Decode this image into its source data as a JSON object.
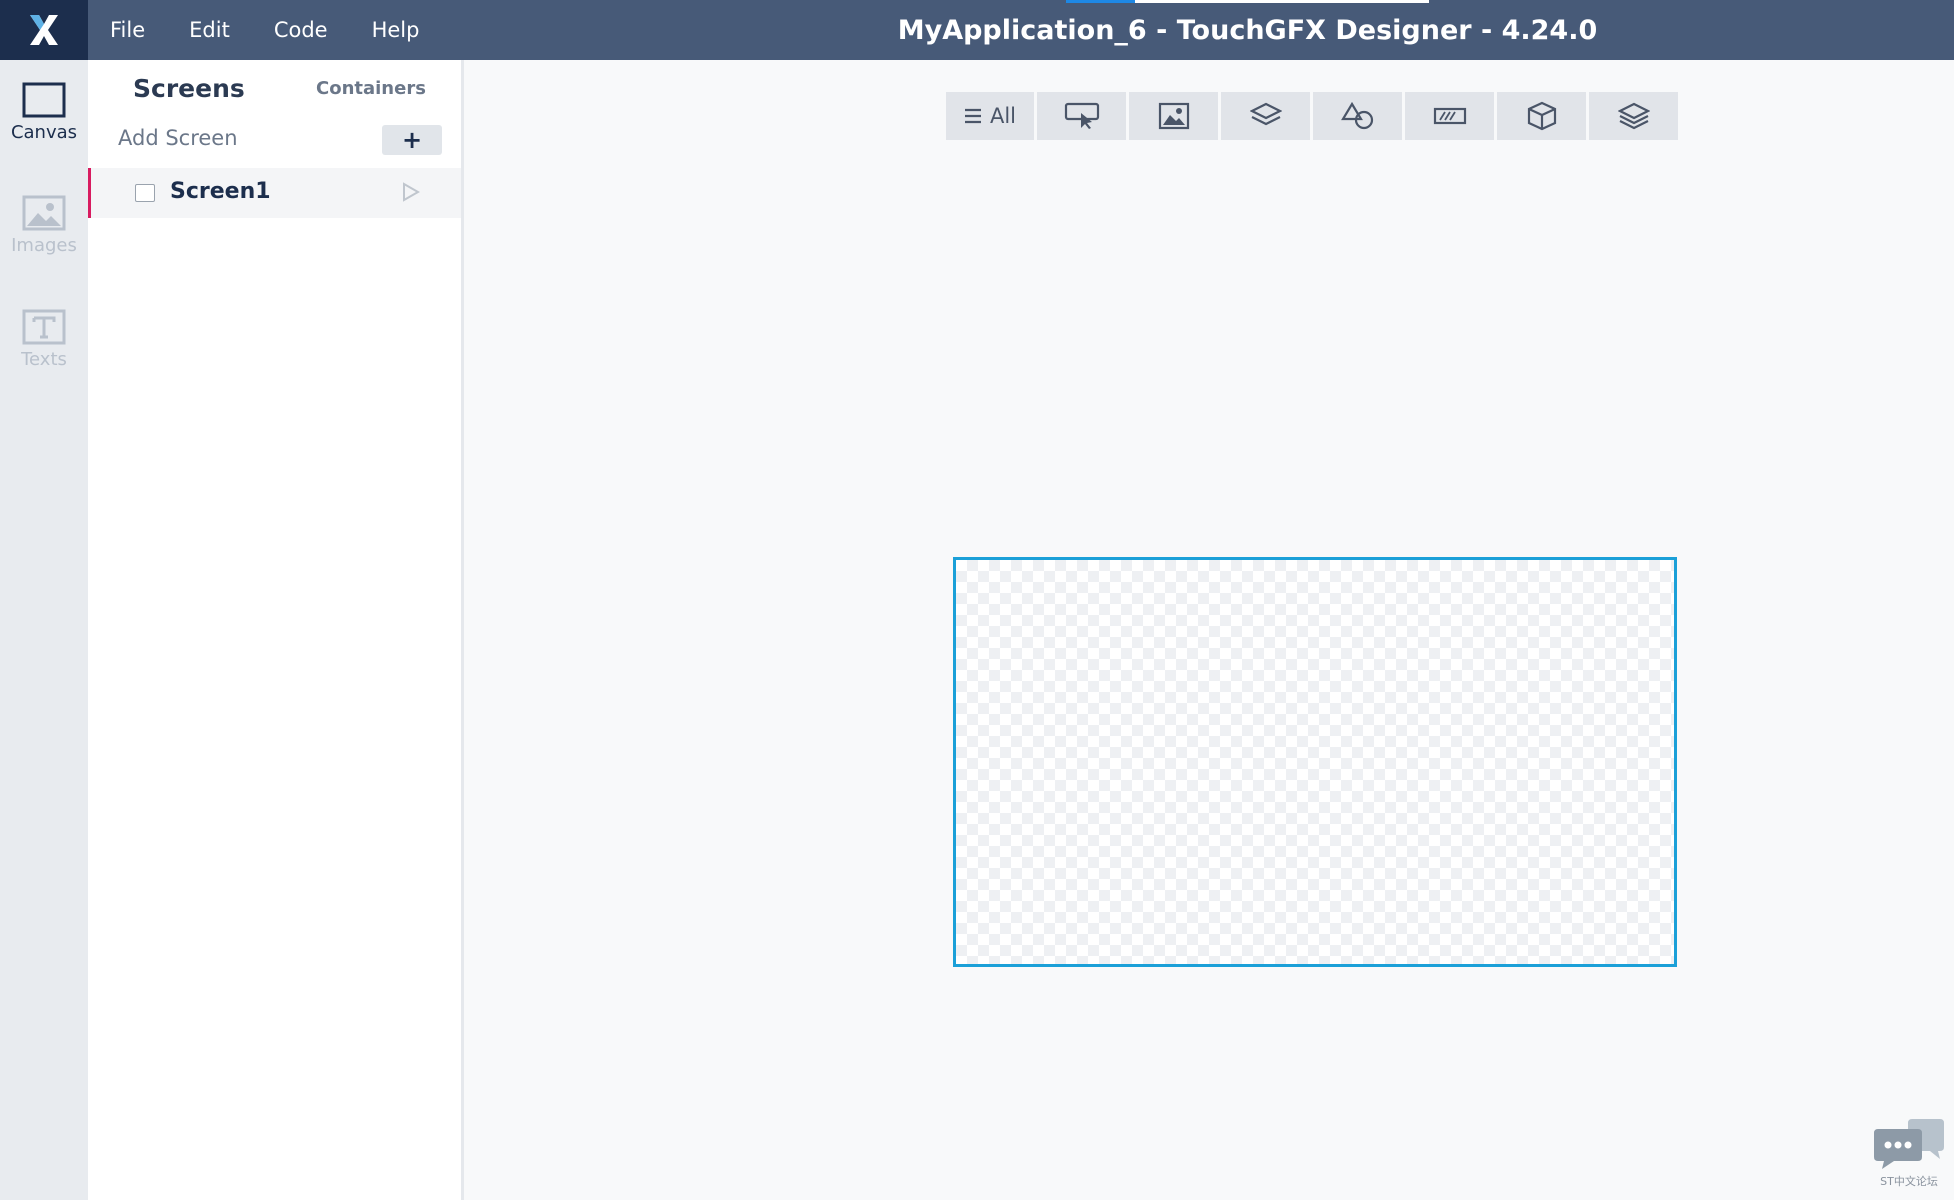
{
  "app": {
    "title": "MyApplication_6 - TouchGFX Designer - 4.24.0",
    "accent": "#475a78",
    "logo_bg": "#1c2e4d"
  },
  "menu": {
    "items": [
      "File",
      "Edit",
      "Code",
      "Help"
    ]
  },
  "rail": {
    "items": [
      {
        "label": "Canvas",
        "icon": "canvas-icon",
        "active": true
      },
      {
        "label": "Images",
        "icon": "image-icon",
        "active": false
      },
      {
        "label": "Texts",
        "icon": "text-icon",
        "active": false
      }
    ]
  },
  "screens_panel": {
    "tab_screens": "Screens",
    "tab_containers": "Containers",
    "add_screen_label": "Add Screen",
    "add_button": "+",
    "screens": [
      {
        "name": "Screen1",
        "selected": true
      }
    ]
  },
  "toolbar": {
    "all_label": "All",
    "filters": [
      "interaction-icon",
      "image-widget-icon",
      "container-icon",
      "shapes-icon",
      "progress-indicator-icon",
      "3d-cube-icon",
      "layers-icon"
    ]
  },
  "canvas": {
    "border_color": "#1ba0d8"
  },
  "watermark": {
    "text": "ST中文论坛"
  }
}
